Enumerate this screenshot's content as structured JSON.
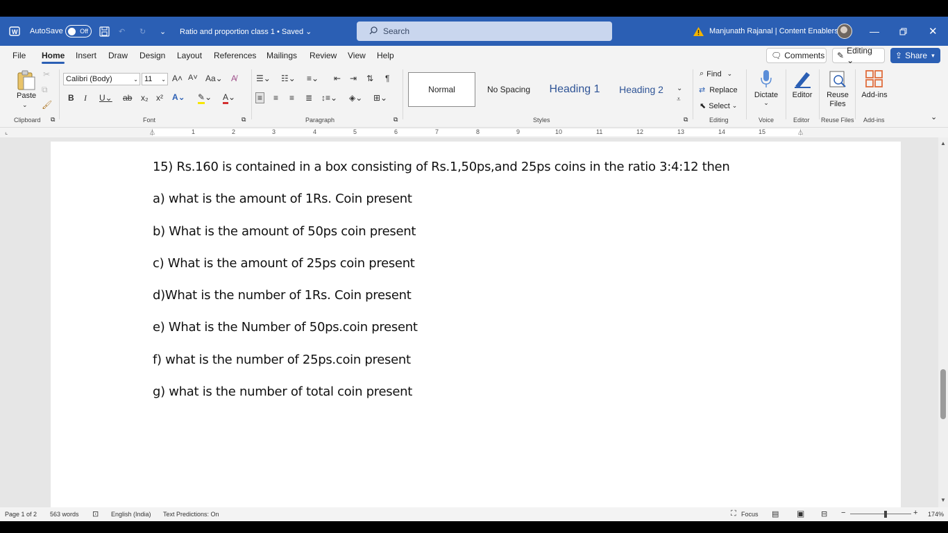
{
  "titlebar": {
    "autosave_label": "AutoSave",
    "autosave_state": "Off",
    "doc_title": "Ratio and proportion class 1 • Saved ⌄",
    "search_placeholder": "Search",
    "user_name": "Manjunath Rajanal | Content Enablers"
  },
  "menu": {
    "tabs": [
      "File",
      "Home",
      "Insert",
      "Draw",
      "Design",
      "Layout",
      "References",
      "Mailings",
      "Review",
      "View",
      "Help"
    ],
    "comments_label": "Comments",
    "editing_label": "Editing ⌄",
    "share_label": "Share"
  },
  "ribbon": {
    "paste_label": "Paste",
    "font_name": "Calibri (Body)",
    "font_size": "11",
    "styles": [
      "Normal",
      "No Spacing",
      "Heading 1",
      "Heading 2"
    ],
    "find_label": "Find",
    "replace_label": "Replace",
    "select_label": "Select",
    "dictate_label": "Dictate",
    "editor_label": "Editor",
    "reuse_files_label": "Reuse Files",
    "addins_label": "Add-ins",
    "group_labels": {
      "clipboard": "Clipboard",
      "font": "Font",
      "paragraph": "Paragraph",
      "styles": "Styles",
      "editing": "Editing",
      "voice": "Voice",
      "editor": "Editor",
      "reuse_files": "Reuse Files",
      "addins": "Add-ins"
    }
  },
  "ruler_numbers": [
    "1",
    "2",
    "3",
    "4",
    "5",
    "6",
    "7",
    "8",
    "9",
    "10",
    "11",
    "12",
    "13",
    "14",
    "15"
  ],
  "document": {
    "lines": [
      "15) Rs.160 is contained in a box consisting of Rs.1,50ps,and 25ps coins in the ratio 3:4:12 then",
      "a) what is the amount of 1Rs. Coin present",
      "b) What is the amount of 50ps coin present",
      "c) What is the amount of 25ps coin present",
      "d)What is the number of 1Rs. Coin present",
      "e) What is the Number of 50ps.coin present",
      "f) what is the number of 25ps.coin present",
      "g) what is the number of total coin present"
    ]
  },
  "statusbar": {
    "page": "Page 1 of 2",
    "words": "563 words",
    "language": "English (India)",
    "text_predictions": "Text Predictions: On",
    "focus": "Focus",
    "zoom": "174%"
  },
  "colors": {
    "title_bar": "#2b5fb4",
    "accent": "#2b5fb4",
    "ribbon_bg": "#f3f3f3",
    "font_color_red": "#d32f2f",
    "highlight_yellow": "#f7e600"
  }
}
